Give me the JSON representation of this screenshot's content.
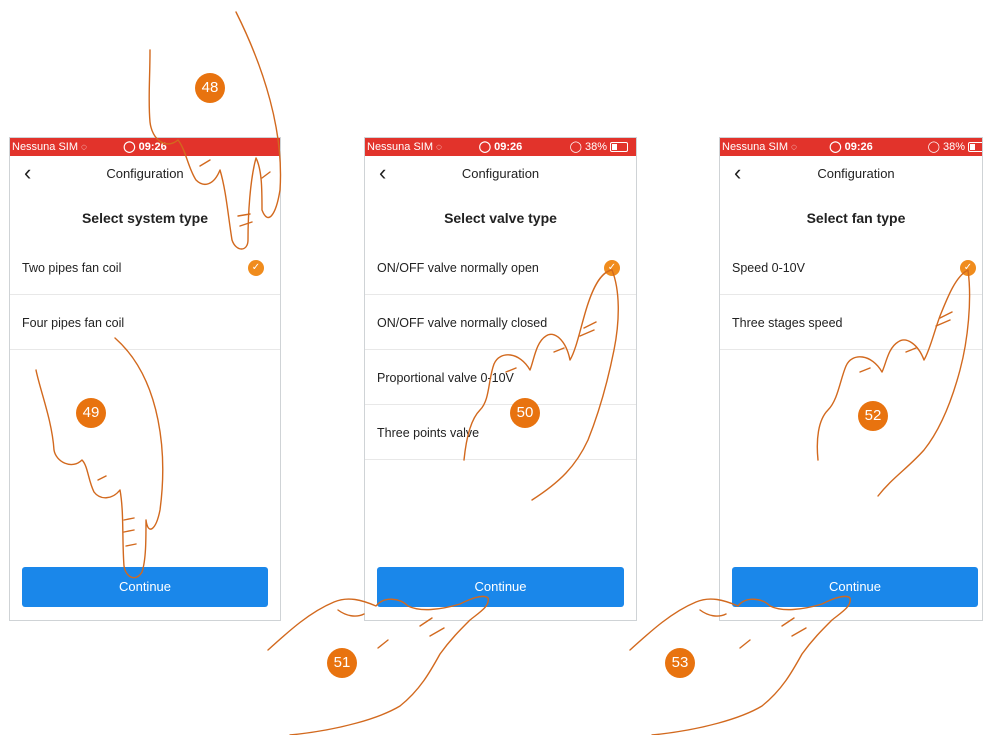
{
  "status": {
    "carrier": "Nessuna SIM",
    "time": "09:26",
    "battery": "38%"
  },
  "screens": [
    {
      "title": "Configuration",
      "heading": "Select system type",
      "options": [
        {
          "label": "Two pipes fan coil",
          "selected": true
        },
        {
          "label": "Four pipes fan coil",
          "selected": false
        }
      ],
      "button": "Continue"
    },
    {
      "title": "Configuration",
      "heading": "Select valve type",
      "options": [
        {
          "label": "ON/OFF valve normally open",
          "selected": true
        },
        {
          "label": "ON/OFF valve normally closed",
          "selected": false
        },
        {
          "label": "Proportional valve 0-10V",
          "selected": false
        },
        {
          "label": "Three points valve",
          "selected": false
        }
      ],
      "button": "Continue"
    },
    {
      "title": "Configuration",
      "heading": "Select fan type",
      "options": [
        {
          "label": "Speed 0-10V",
          "selected": true
        },
        {
          "label": "Three stages speed",
          "selected": false
        }
      ],
      "button": "Continue"
    }
  ],
  "steps": [
    "48",
    "49",
    "50",
    "51",
    "52",
    "53"
  ],
  "colors": {
    "status_bar": "#e2332b",
    "accent": "#f08c1d",
    "button": "#1a87ea",
    "badge": "#e8730f",
    "hand_outline": "#d2691e"
  },
  "icons": {
    "back": "chevron-left-icon",
    "check": "checkmark-icon",
    "wifi": "wifi-icon",
    "alarm": "alarm-icon",
    "battery": "battery-icon"
  }
}
